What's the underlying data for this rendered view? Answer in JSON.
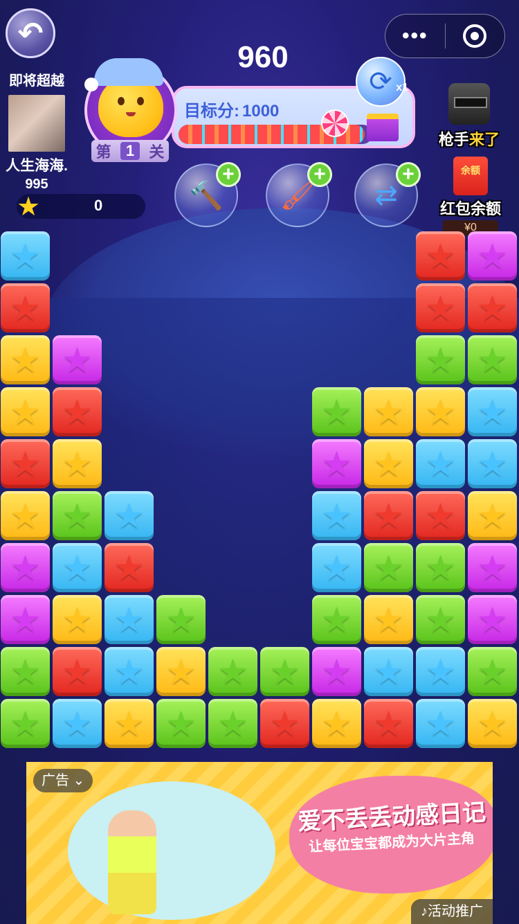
{
  "header": {
    "score": "960",
    "menu_dots": "•••",
    "back_glyph": "↶"
  },
  "player": {
    "label": "即将超越",
    "name": "人生海海.",
    "score": "995"
  },
  "stars": {
    "value": "0"
  },
  "level": {
    "prefix": "第",
    "number": "1",
    "suffix": "关"
  },
  "target": {
    "label": "目标分:",
    "value": "1000",
    "progress_fraction": 0.96
  },
  "refresh": {
    "count": "x1"
  },
  "powerups": [
    {
      "name": "hammer",
      "icon": "hammer-icon",
      "glyph": "🔨"
    },
    {
      "name": "paint-brush",
      "icon": "brush-icon",
      "glyph": "🖌"
    },
    {
      "name": "shuffle",
      "icon": "shuffle-icon",
      "glyph": "⇄"
    }
  ],
  "right": {
    "gunner_a": "枪手",
    "gunner_b": "来了",
    "envelope": "余额",
    "redpack_label": "红包余额",
    "balance": "¥0"
  },
  "board": {
    "columns": 10,
    "rows": 10,
    "colors": {
      "blue": "#34b5f2",
      "red": "#e2261f",
      "yellow": "#ffb814",
      "purple": "#c626e6",
      "green": "#58c21a"
    },
    "grid": [
      [
        "blue",
        null,
        null,
        null,
        null,
        null,
        null,
        null,
        "red",
        "purple"
      ],
      [
        "red",
        null,
        null,
        null,
        null,
        null,
        null,
        null,
        "red",
        "red"
      ],
      [
        "yellow",
        "purple",
        null,
        null,
        null,
        null,
        null,
        null,
        "green",
        "green"
      ],
      [
        "yellow",
        "red",
        null,
        null,
        null,
        null,
        "green",
        "yellow",
        "yellow",
        "blue"
      ],
      [
        "red",
        "yellow",
        null,
        null,
        null,
        null,
        "purple",
        "yellow",
        "blue",
        "blue"
      ],
      [
        "yellow",
        "green",
        "blue",
        null,
        null,
        null,
        "blue",
        "red",
        "red",
        "yellow"
      ],
      [
        "purple",
        "blue",
        "red",
        null,
        null,
        null,
        "blue",
        "green",
        "green",
        "purple"
      ],
      [
        "purple",
        "yellow",
        "blue",
        "green",
        null,
        null,
        "green",
        "yellow",
        "green",
        "purple"
      ],
      [
        "green",
        "red",
        "blue",
        "yellow",
        "green",
        "green",
        "purple",
        "blue",
        "blue",
        "green"
      ],
      [
        "green",
        "blue",
        "yellow",
        "green",
        "green",
        "red",
        "yellow",
        "red",
        "blue",
        "yellow"
      ]
    ]
  },
  "ad": {
    "tag": "广告 ⌄",
    "headline": "爱不丢丢动感日记",
    "subline": "让每位宝宝都成为大片主角",
    "promo": "♪活动推广"
  }
}
